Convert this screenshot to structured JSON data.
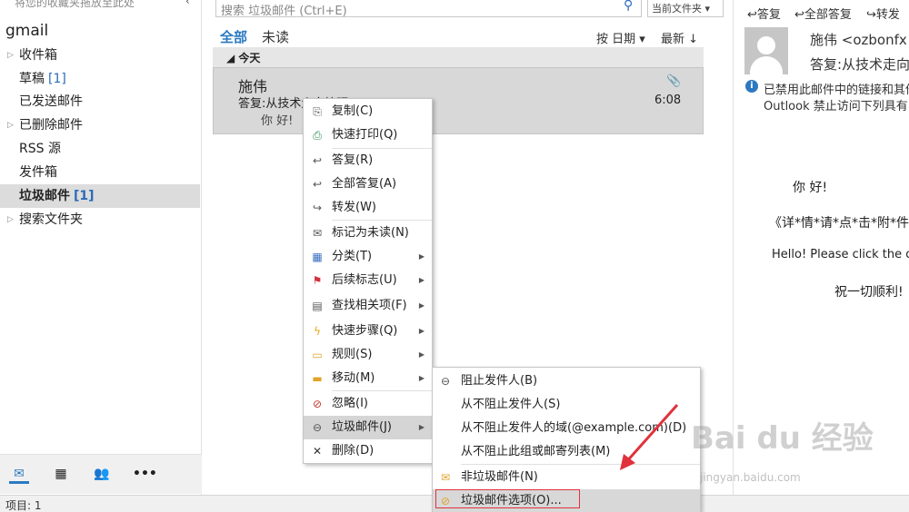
{
  "nav": {
    "hint": "将您的收藏夹拖放至此处",
    "account": "gmail",
    "items": [
      {
        "label": "收件箱",
        "count": "",
        "expand": true
      },
      {
        "label": "草稿",
        "count": "[1]",
        "expand": false
      },
      {
        "label": "已发送邮件",
        "count": "",
        "expand": false
      },
      {
        "label": "已删除邮件",
        "count": "",
        "expand": true
      },
      {
        "label": "RSS 源",
        "count": "",
        "expand": false
      },
      {
        "label": "发件箱",
        "count": "",
        "expand": false
      },
      {
        "label": "垃圾邮件",
        "count": "[1]",
        "expand": false,
        "selected": true
      },
      {
        "label": "搜索文件夹",
        "count": "",
        "expand": true
      }
    ],
    "bottom_icons": [
      "mail-icon",
      "calendar-icon",
      "people-icon",
      "more-icon"
    ]
  },
  "search": {
    "placeholder": "搜索 垃圾邮件 (Ctrl+E)",
    "scope": "当前文件夹"
  },
  "filters": {
    "all": "全部",
    "unread": "未读",
    "sort_by": "按 日期",
    "order": "最新"
  },
  "list": {
    "group": "今天",
    "message": {
      "sender": "施伟",
      "subject": "答复:从技术走向管理",
      "preview": "你 好!",
      "time": "6:08"
    }
  },
  "reading": {
    "actions": {
      "reply": "答复",
      "reply_all": "全部答复",
      "forward": "转发"
    },
    "from": "施伟 <ozbonfx",
    "subject": "答复:从技术走向",
    "info1": "已禁用此邮件中的链接和其他",
    "info2": "Outlook 禁止访问下列具有",
    "body": [
      "你 好!",
      "《详*情*请*点*击*附*件",
      "Hello! Please click the do",
      "祝一切顺利!"
    ]
  },
  "status": "项目: 1",
  "context_menu": [
    {
      "label": "复制(C)",
      "icon": "copy-icon",
      "sub": false
    },
    {
      "label": "快速打印(Q)",
      "icon": "print-icon",
      "sub": false
    },
    {
      "label": "答复(R)",
      "icon": "reply-icon",
      "sub": false
    },
    {
      "label": "全部答复(A)",
      "icon": "reply-all-icon",
      "sub": false
    },
    {
      "label": "转发(W)",
      "icon": "forward-icon",
      "sub": false
    },
    {
      "label": "标记为未读(N)",
      "icon": "mark-unread-icon",
      "sub": false
    },
    {
      "label": "分类(T)",
      "icon": "categorize-icon",
      "sub": true
    },
    {
      "label": "后续标志(U)",
      "icon": "flag-icon",
      "sub": true
    },
    {
      "label": "查找相关项(F)",
      "icon": "find-related-icon",
      "sub": true
    },
    {
      "label": "快速步骤(Q)",
      "icon": "quick-steps-icon",
      "sub": true
    },
    {
      "label": "规则(S)",
      "icon": "rules-icon",
      "sub": true
    },
    {
      "label": "移动(M)",
      "icon": "move-icon",
      "sub": true
    },
    {
      "label": "忽略(I)",
      "icon": "ignore-icon",
      "sub": false
    },
    {
      "label": "垃圾邮件(J)",
      "icon": "junk-icon",
      "sub": true,
      "highlight": true
    },
    {
      "label": "删除(D)",
      "icon": "delete-icon",
      "sub": false
    }
  ],
  "junk_submenu": [
    {
      "label": "阻止发件人(B)",
      "icon": "block-sender-icon"
    },
    {
      "label": "从不阻止发件人(S)",
      "icon": ""
    },
    {
      "label": "从不阻止发件人的域(@example.com)(D)",
      "icon": ""
    },
    {
      "label": "从不阻止此组或邮寄列表(M)",
      "icon": ""
    },
    {
      "label": "非垃圾邮件(N)",
      "icon": "not-junk-icon"
    },
    {
      "label": "垃圾邮件选项(O)...",
      "icon": "junk-options-icon",
      "highlight": true
    }
  ],
  "watermark": {
    "text": "Bai du 经验",
    "url": "jingyan.baidu.com"
  },
  "colors": {
    "accent": "#2b79c2",
    "highlight_box": "#e0323c",
    "arrow": "#e0323c"
  }
}
